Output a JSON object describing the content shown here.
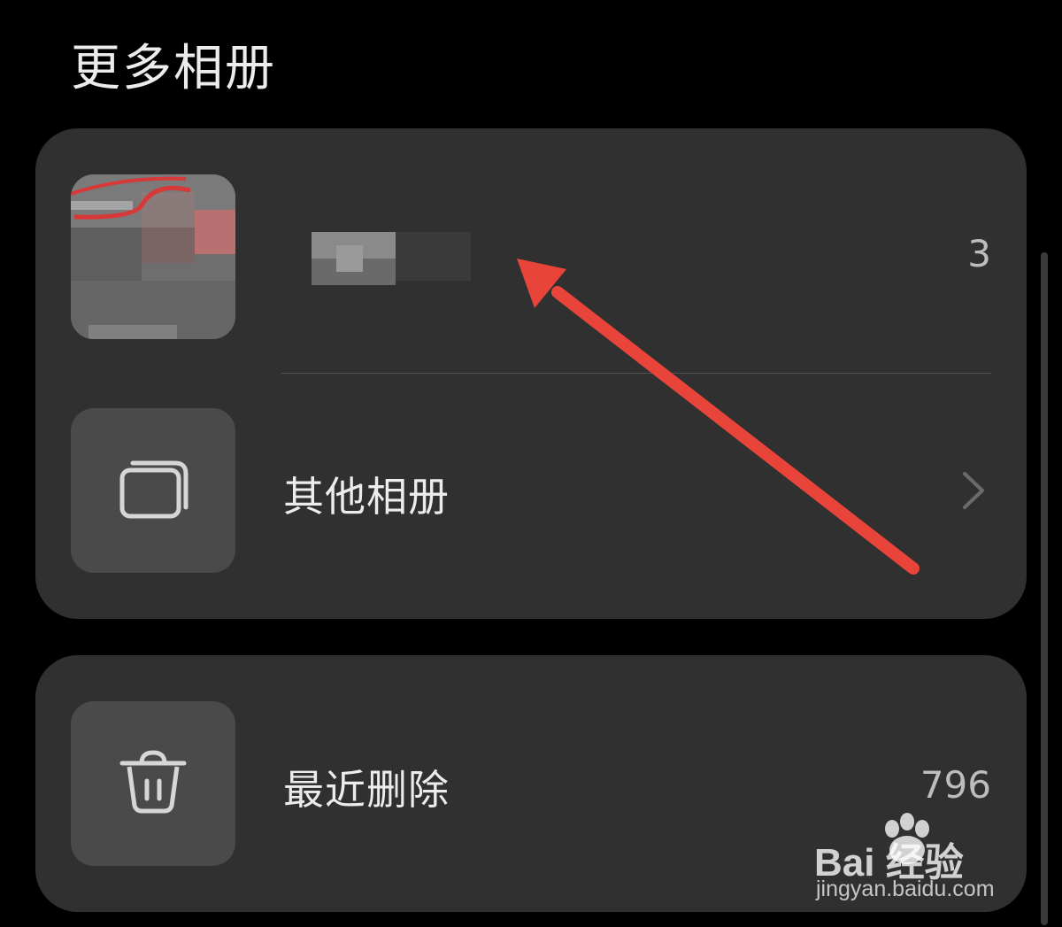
{
  "header": {
    "title": "更多相册"
  },
  "albums_card": {
    "hidden_album": {
      "count": "3"
    },
    "other_albums": {
      "label": "其他相册"
    }
  },
  "trash_card": {
    "recently_deleted": {
      "label": "最近删除",
      "count": "796"
    }
  },
  "watermark": {
    "logo_text": "Bai 经验",
    "url": "jingyan.baidu.com"
  },
  "colors": {
    "background": "#000000",
    "card": "#303030",
    "tile": "#4a4a4a",
    "text_primary": "#ececec",
    "text_secondary": "#bdbdbd",
    "annotation_arrow": "#e8443a"
  },
  "icons": {
    "other_albums": "stacked-albums-icon",
    "recently_deleted": "trash-icon",
    "chevron": "chevron-right-icon"
  }
}
